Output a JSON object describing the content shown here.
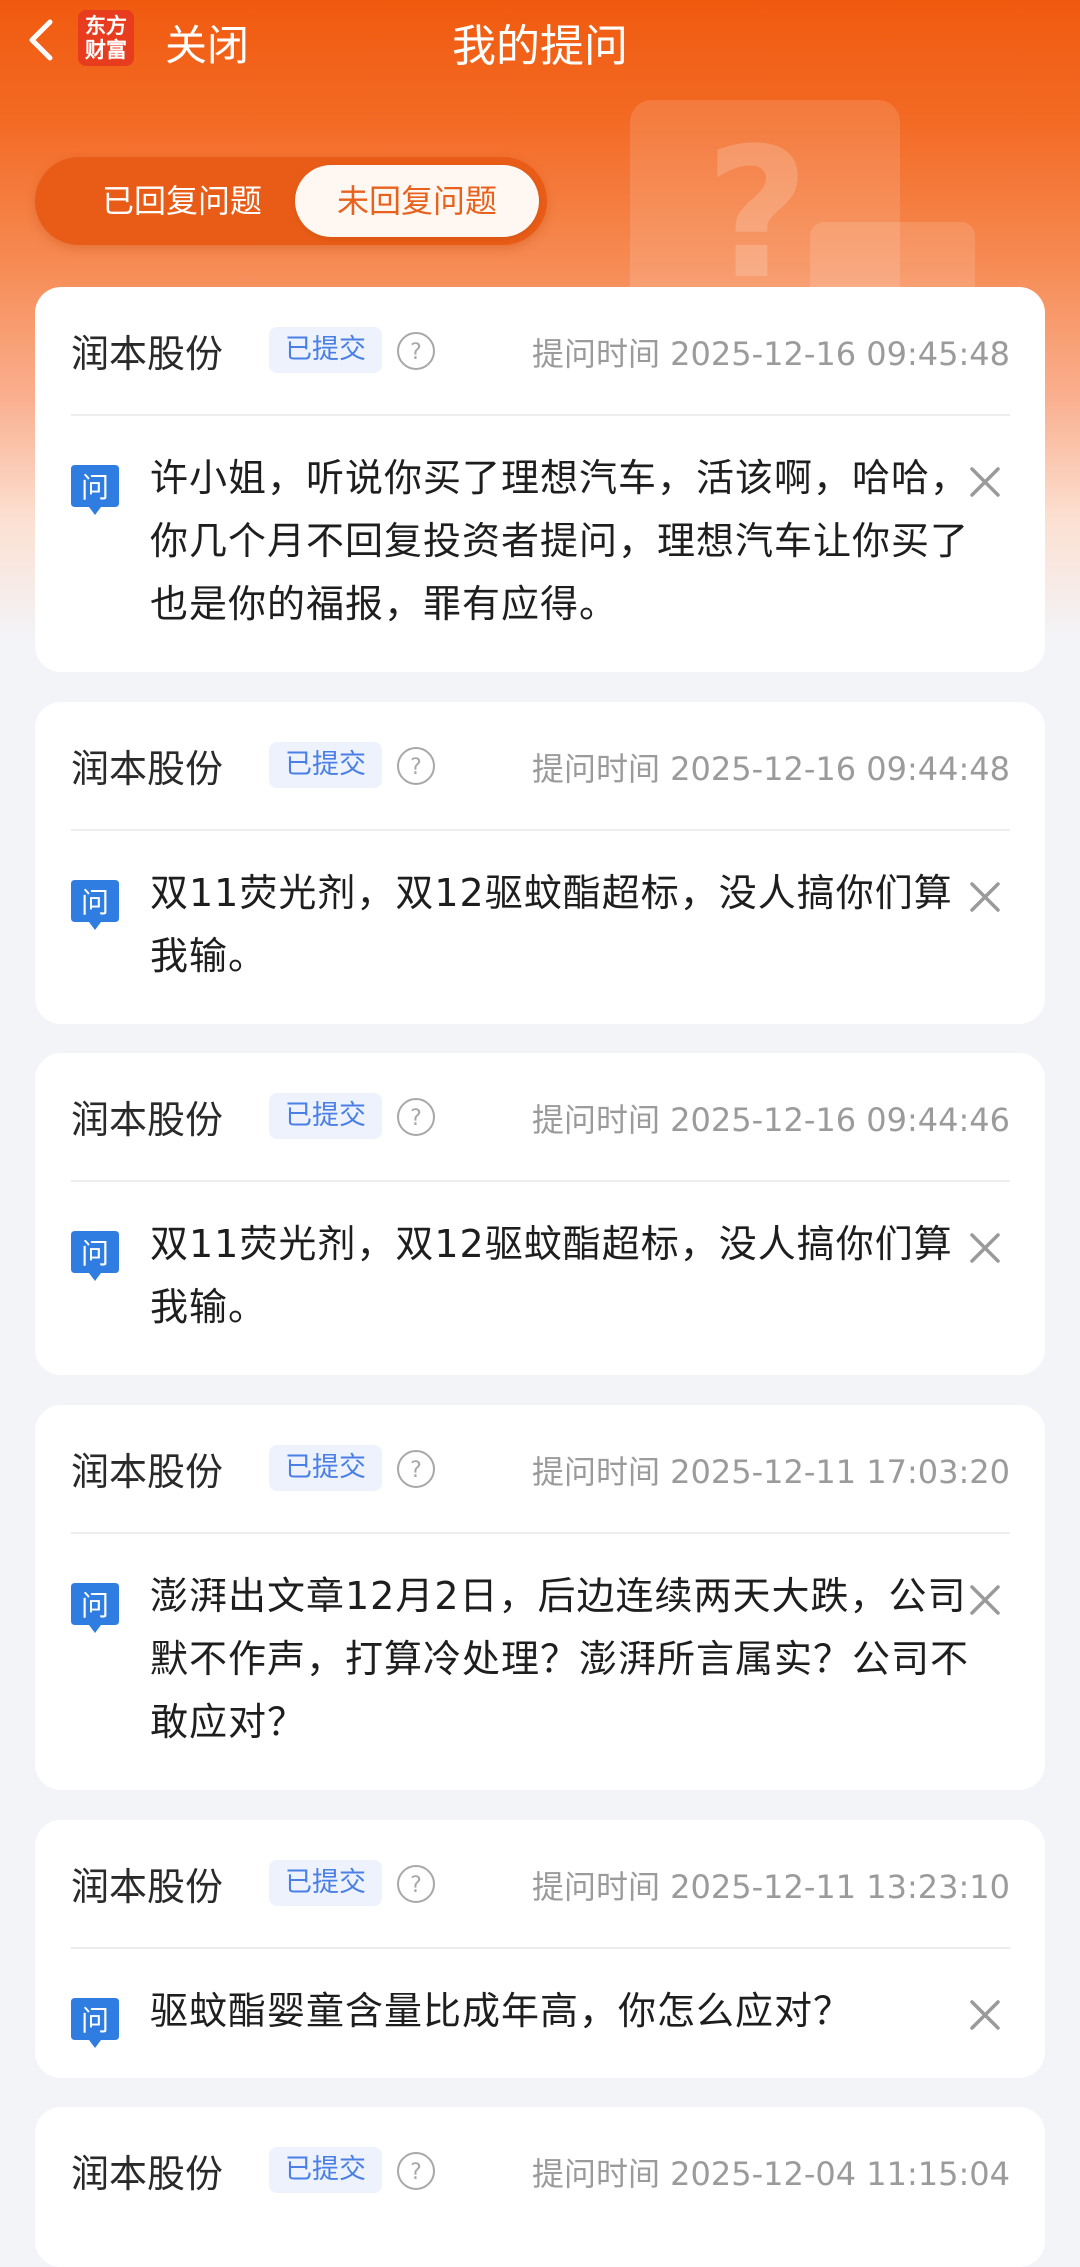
{
  "header": {
    "back_icon": "chevron-left-icon",
    "logo_text": "东方财富",
    "logo_line1": "东方",
    "logo_line2": "财富",
    "close_label": "关闭",
    "title": "我的提问"
  },
  "tabs": [
    {
      "label": "已回复问题",
      "selected": false
    },
    {
      "label": "未回复问题",
      "selected": true
    }
  ],
  "colors": {
    "brand": "#f05a0f",
    "badge_text": "#4a7fe6",
    "ask_icon": "#2f7de1"
  },
  "time_label": "提问时间",
  "questions": [
    {
      "company": "润本股份",
      "status": "已提交",
      "time": "2025-12-16 09:45:48",
      "time_text": "提问时间 2025-12-16 09:45:48",
      "icon_label": "问",
      "text": "许小姐，听说你买了理想汽车，活该啊，哈哈，你几个月不回复投资者提问，理想汽车让你买了也是你的福报，罪有应得。"
    },
    {
      "company": "润本股份",
      "status": "已提交",
      "time": "2025-12-16 09:44:48",
      "time_text": "提问时间 2025-12-16 09:44:48",
      "icon_label": "问",
      "text": "双11荧光剂，双12驱蚊酯超标，没人搞你们算我输。"
    },
    {
      "company": "润本股份",
      "status": "已提交",
      "time": "2025-12-16 09:44:46",
      "time_text": "提问时间 2025-12-16 09:44:46",
      "icon_label": "问",
      "text": "双11荧光剂，双12驱蚊酯超标，没人搞你们算我输。"
    },
    {
      "company": "润本股份",
      "status": "已提交",
      "time": "2025-12-11 17:03:20",
      "time_text": "提问时间 2025-12-11 17:03:20",
      "icon_label": "问",
      "text": "澎湃出文章12月2日，后边连续两天大跌，公司默不作声，打算冷处理？澎湃所言属实？公司不敢应对？"
    },
    {
      "company": "润本股份",
      "status": "已提交",
      "time": "2025-12-11 13:23:10",
      "time_text": "提问时间 2025-12-11 13:23:10",
      "icon_label": "问",
      "text": "驱蚊酯婴童含量比成年高，你怎么应对？"
    },
    {
      "company": "润本股份",
      "status": "已提交",
      "time": "2025-12-04 11:15:04",
      "time_text": "提问时间 2025-12-04 11:15:04",
      "icon_label": "问",
      "text": ""
    }
  ]
}
